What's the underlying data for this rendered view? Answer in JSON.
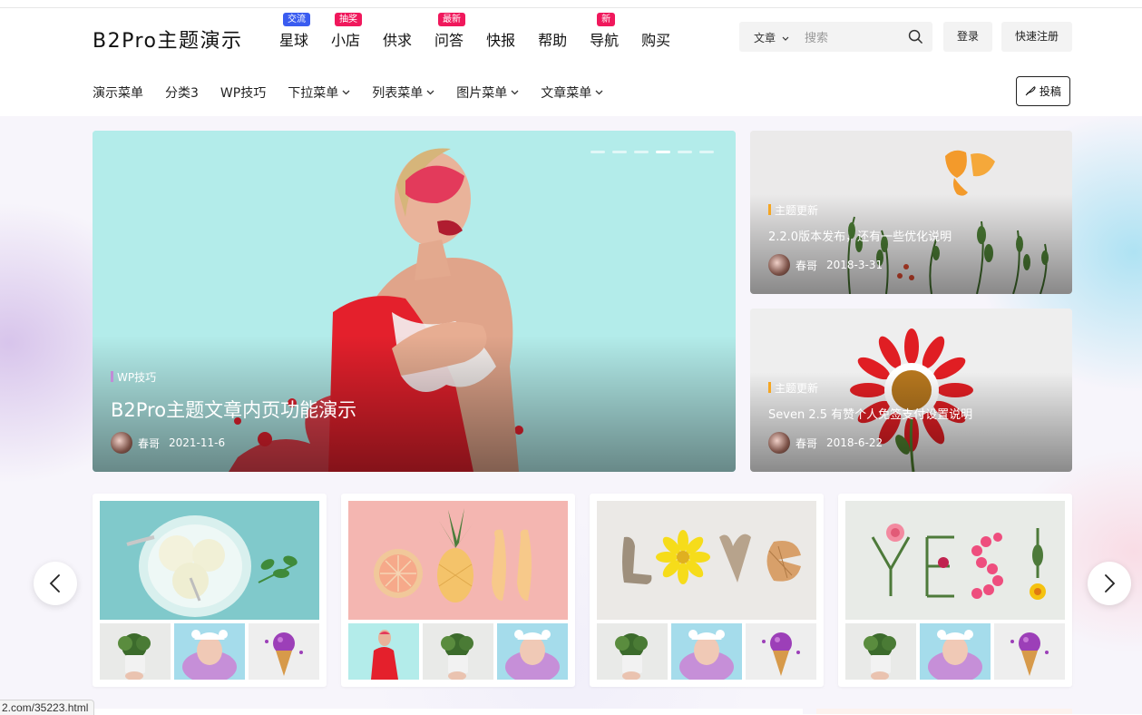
{
  "header": {
    "logo": "B2Pro主题演示",
    "nav": [
      {
        "label": "星球",
        "badge": "交流",
        "badge_color": "#3a5cf0"
      },
      {
        "label": "小店",
        "badge": "抽奖",
        "badge_color": "#f0185c"
      },
      {
        "label": "供求"
      },
      {
        "label": "问答",
        "badge": "最新",
        "badge_color": "#f0185c"
      },
      {
        "label": "快报"
      },
      {
        "label": "帮助"
      },
      {
        "label": "导航",
        "badge": "新",
        "badge_color": "#f0185c"
      },
      {
        "label": "购买"
      }
    ],
    "search": {
      "category": "文章",
      "placeholder": "搜索"
    },
    "login_label": "登录",
    "register_label": "快速注册"
  },
  "subnav": {
    "items": [
      {
        "label": "演示菜单"
      },
      {
        "label": "分类3"
      },
      {
        "label": "WP技巧"
      },
      {
        "label": "下拉菜单",
        "dropdown": true
      },
      {
        "label": "列表菜单",
        "dropdown": true
      },
      {
        "label": "图片菜单",
        "dropdown": true
      },
      {
        "label": "文章菜单",
        "dropdown": true
      }
    ],
    "post_label": "投稿"
  },
  "hero": {
    "category": "WP技巧",
    "category_color": "#c18bd6",
    "title": "B2Pro主题文章内页功能演示",
    "author": "春哥",
    "date": "2021-11-6",
    "slide_count": 6,
    "active_slide": 4
  },
  "side_posts": [
    {
      "category": "主题更新",
      "category_color": "#f5a623",
      "title": "2.2.0版本发布，还有一些优化说明",
      "author": "春哥",
      "date": "2018-3-31"
    },
    {
      "category": "主题更新",
      "category_color": "#f5a623",
      "title": "Seven 2.5 有赞个人免签支付设置说明",
      "author": "春哥",
      "date": "2018-6-22"
    }
  ],
  "galleries": [
    {
      "main": "ice-cream-bowl",
      "thumbs": [
        "flower-pot",
        "girl-bear-hat",
        "ice-cream-cone"
      ]
    },
    {
      "main": "fruit-shoes",
      "thumbs": [
        "splash-girl",
        "flower-pot",
        "girl-bear-hat"
      ]
    },
    {
      "main": "love-shells",
      "thumbs": [
        "flower-pot",
        "girl-bear-hat",
        "ice-cream-cone"
      ]
    },
    {
      "main": "yes-flowers",
      "thumbs": [
        "flower-pot",
        "girl-bear-hat",
        "ice-cream-cone"
      ]
    }
  ],
  "status_bar": {
    "url": "2.com/35223.html"
  }
}
